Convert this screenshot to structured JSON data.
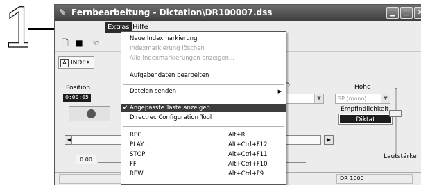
{
  "step_number": "1",
  "window": {
    "title": "Fernbearbeitung - Dictation\\DR100007.dss"
  },
  "menubar": {
    "items": [
      {
        "label": "Extras"
      },
      {
        "label": "Hilfe"
      }
    ]
  },
  "toolbar2": {
    "index_label": "INDEX",
    "index_badge": "A"
  },
  "main": {
    "position_label": "Position",
    "position_value": "0:00:05",
    "hohe_label": "Hohe",
    "hohe_select": "SP (mono)",
    "id_label": "D",
    "empfindlichkeit_label": "Empfindlichkeit",
    "diktat_value": "Diktat",
    "time_value": "0.00",
    "lautstarke_label": "Lautstärke"
  },
  "statusbar": {
    "device": "DR 1000"
  },
  "extras_menu": {
    "items": [
      {
        "label": "Neue Indexmarkierung",
        "shortcut": "",
        "disabled": false,
        "checked": false,
        "submenu": false
      },
      {
        "label": "Indexmarkierung löschen",
        "shortcut": "",
        "disabled": true,
        "checked": false,
        "submenu": false
      },
      {
        "label": "Alle Indexmarkierungen anzeigen...",
        "shortcut": "",
        "disabled": true,
        "checked": false,
        "submenu": false
      },
      {
        "label": "Aufgabendaten bearbeiten",
        "shortcut": "",
        "disabled": false,
        "checked": false,
        "submenu": false
      },
      {
        "label": "Dateien senden",
        "shortcut": "",
        "disabled": false,
        "checked": false,
        "submenu": true
      },
      {
        "label": "Angepasste Taste anzeigen",
        "shortcut": "",
        "disabled": false,
        "checked": true,
        "submenu": false,
        "highlighted": true
      },
      {
        "label": "Directrec Configuration Tool",
        "shortcut": "",
        "disabled": false,
        "checked": false,
        "submenu": false
      },
      {
        "label": "REC",
        "shortcut": "Alt+R"
      },
      {
        "label": "PLAY",
        "shortcut": "Alt+Ctrl+F12"
      },
      {
        "label": "STOP",
        "shortcut": "Alt+Ctrl+F11"
      },
      {
        "label": "FF",
        "shortcut": "Alt+Ctrl+F10"
      },
      {
        "label": "REW",
        "shortcut": "Alt+Ctrl+F9"
      }
    ]
  },
  "colors": {
    "titlebar_dark": "#3c3c3c",
    "menu_highlight": "#3c3c3c",
    "display_bg": "#1c1c1c"
  },
  "icons": [
    "pencil-icon",
    "new-document-icon",
    "save-icon",
    "hand-icon",
    "minimize-icon",
    "maximize-icon",
    "close-icon",
    "checkmark-icon",
    "submenu-arrow-icon"
  ]
}
